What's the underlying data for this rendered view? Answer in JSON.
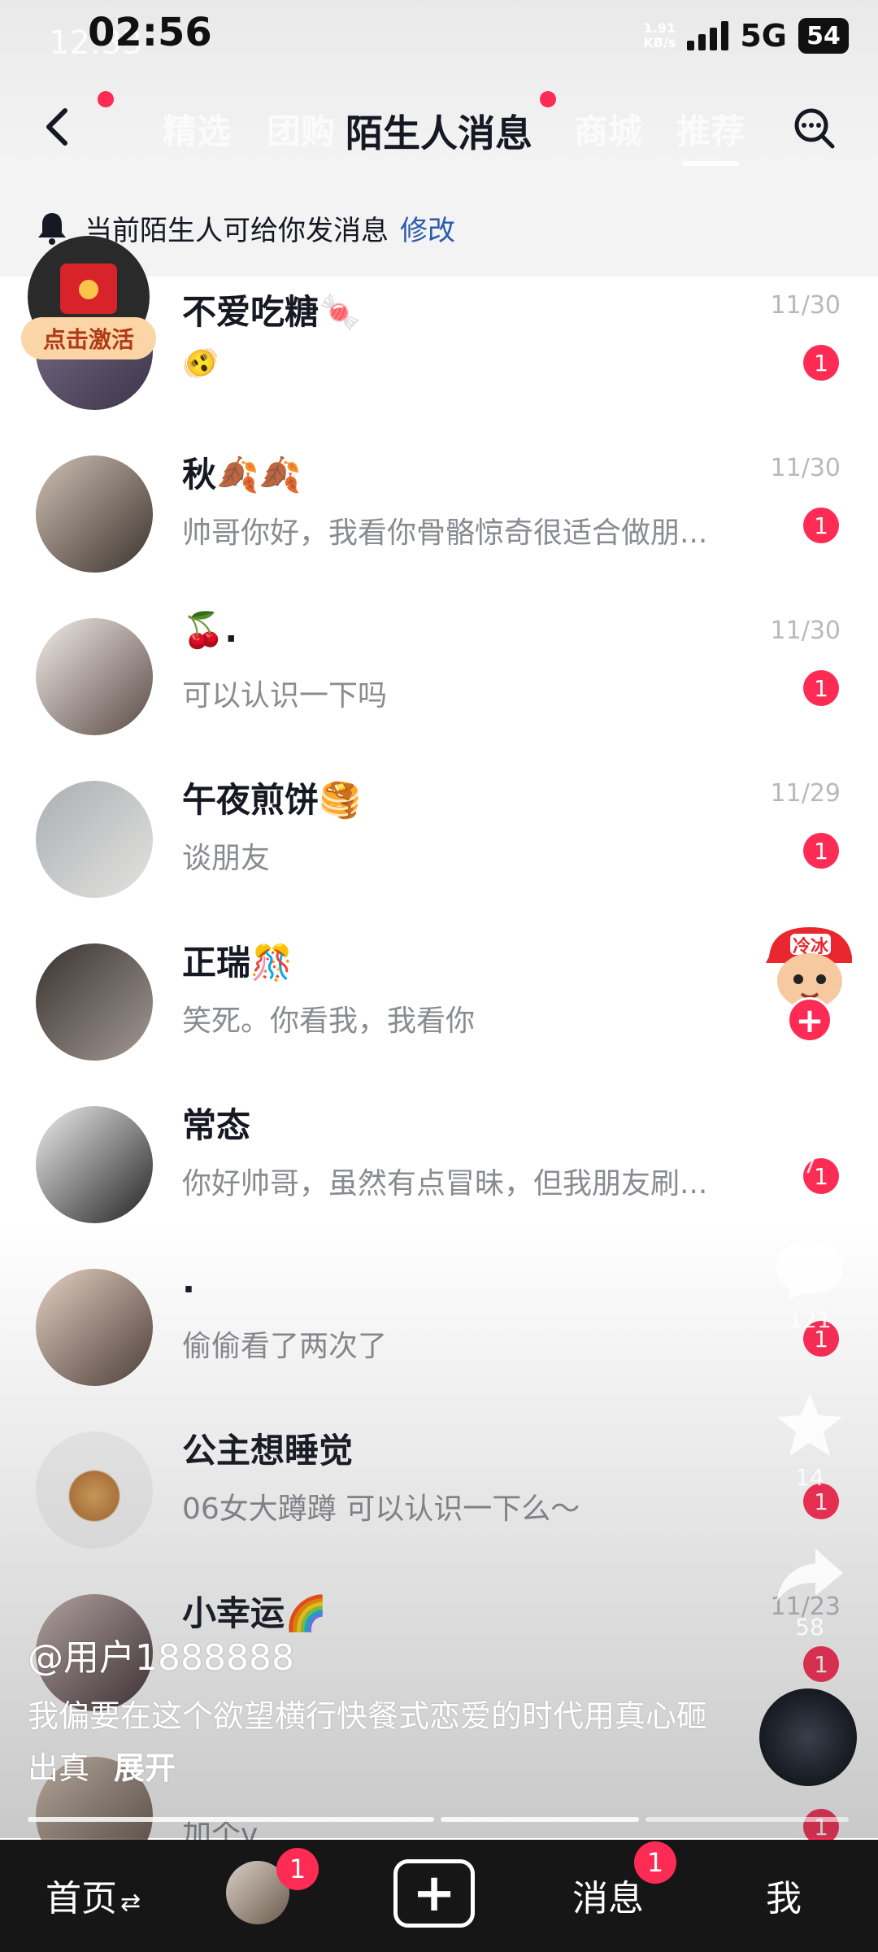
{
  "status_bar": {
    "ghost_time": "12:33",
    "time": "02:56",
    "net_speed_value": "1.91",
    "net_speed_unit": "KB/s",
    "network": "5G",
    "battery": "54"
  },
  "nav": {
    "title": "陌生人消息",
    "ghost_tabs": [
      "精选",
      "团购",
      "商城",
      "推荐"
    ],
    "accent_color": "#fe2c55"
  },
  "notice": {
    "text": "当前陌生人可给你发消息",
    "link": "修改"
  },
  "messages": [
    {
      "name": "不爱吃糖🍬",
      "preview": "🫨",
      "date": "11/30",
      "unread": "1"
    },
    {
      "name": "秋🍂🍂",
      "preview": "帅哥你好，我看你骨骼惊奇很适合做朋...",
      "date": "11/30",
      "unread": "1"
    },
    {
      "name": "🍒.",
      "preview": "可以认识一下吗",
      "date": "11/30",
      "unread": "1"
    },
    {
      "name": "午夜煎饼🥞",
      "preview": "谈朋友",
      "date": "11/29",
      "unread": "1"
    },
    {
      "name": "正瑞🎊",
      "preview": "笑死。你看我，我看你",
      "date": "",
      "unread": ""
    },
    {
      "name": "常态",
      "preview": "你好帅哥，虽然有点冒昧，但我朋友刷...",
      "date": "",
      "unread": "1"
    },
    {
      "name": ".",
      "preview": "偷偷看了两次了",
      "date": "",
      "unread": "1"
    },
    {
      "name": "公主想睡觉",
      "preview": "06女大蹲蹲 可以认识一下么～",
      "date": "",
      "unread": "1"
    },
    {
      "name": "小幸运🌈",
      "preview": "",
      "date": "11/23",
      "unread": "1"
    },
    {
      "name": "",
      "preview": "加个v",
      "date": "",
      "unread": "1"
    }
  ],
  "overlay": {
    "redpacket_label": "点击激活",
    "creator_tag": "冷冰",
    "follow_symbol": "+",
    "actions": [
      {
        "icon": "heart-icon",
        "count": "7"
      },
      {
        "icon": "comment-icon",
        "count": "121"
      },
      {
        "icon": "star-icon",
        "count": "14"
      },
      {
        "icon": "share-icon",
        "count": "58"
      }
    ],
    "author": "@用户1888888",
    "caption": "我偏要在这个欲望横行快餐式恋爱的时代用真心砸出真",
    "caption_more": "展开",
    "progress_segments": 3
  },
  "tab_bar": {
    "home": "首页",
    "home_suffix": "⇄",
    "friends_badge": "1",
    "create_symbol": "+",
    "messages": "消息",
    "messages_badge": "1",
    "me": "我"
  }
}
